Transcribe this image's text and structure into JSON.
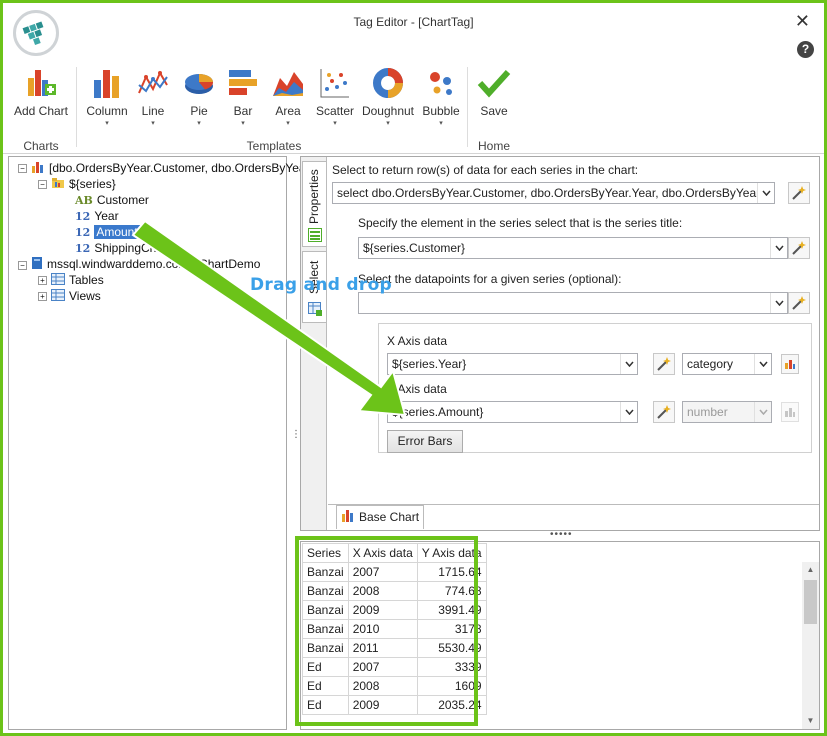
{
  "window": {
    "title": "Tag Editor - [ChartTag]",
    "close_glyph": "✕",
    "help_glyph": "?"
  },
  "ribbon": {
    "buttons": [
      {
        "label": "Add Chart",
        "icon": "add-chart-icon"
      },
      {
        "label": "Column",
        "icon": "column-chart-icon"
      },
      {
        "label": "Line",
        "icon": "line-chart-icon"
      },
      {
        "label": "Pie",
        "icon": "pie-chart-icon"
      },
      {
        "label": "Bar",
        "icon": "bar-chart-icon"
      },
      {
        "label": "Area",
        "icon": "area-chart-icon"
      },
      {
        "label": "Scatter",
        "icon": "scatter-chart-icon"
      },
      {
        "label": "Doughnut",
        "icon": "doughnut-chart-icon"
      },
      {
        "label": "Bubble",
        "icon": "bubble-chart-icon"
      },
      {
        "label": "Save",
        "icon": "save-checkmark-icon"
      }
    ],
    "groups": [
      "Charts",
      "Templates",
      "Home"
    ],
    "dropdown_glyph": "▾"
  },
  "tree": {
    "root": "[dbo.OrdersByYear.Customer, dbo.OrdersByYear.Year",
    "series": "${series}",
    "fields": [
      {
        "type": "AB",
        "name": "Customer"
      },
      {
        "type": "12",
        "name": "Year"
      },
      {
        "type": "12",
        "name": "Amount"
      },
      {
        "type": "12",
        "name": "ShippingCharge"
      }
    ],
    "datasource": "mssql.windwarddemo.com - ChartDemo",
    "children": [
      "Tables",
      "Views"
    ],
    "expand_minus": "−",
    "expand_plus": "+"
  },
  "tabs": {
    "vertical": [
      "Properties",
      "Select"
    ],
    "bottom": "Base Chart"
  },
  "form": {
    "select_label": "Select to return row(s) of data for each series in the chart:",
    "select_value": "select dbo.OrdersByYear.Customer, dbo.OrdersByYear.Year, dbo.OrdersByYear.Amount",
    "title_label": "Specify the element in the series select that is the series title:",
    "title_value": "${series.Customer}",
    "datapoints_label": "Select the datapoints for a given series (optional):",
    "datapoints_value": "",
    "x_label": "X Axis data",
    "x_value": "${series.Year}",
    "x_type": "category",
    "y_label": "Y Axis data",
    "y_value": "${series.Amount}",
    "y_type": "number",
    "error_bars": "Error Bars"
  },
  "annotation": {
    "text": "Drag and drop",
    "color": "#6cc319"
  },
  "grid": {
    "headers": [
      "Series",
      "X Axis data",
      "Y Axis data"
    ],
    "rows": [
      [
        "Banzai",
        "2007",
        "1715.64"
      ],
      [
        "Banzai",
        "2008",
        "774.68"
      ],
      [
        "Banzai",
        "2009",
        "3991.49"
      ],
      [
        "Banzai",
        "2010",
        "3178"
      ],
      [
        "Banzai",
        "2011",
        "5530.49"
      ],
      [
        "Ed",
        "2007",
        "3339"
      ],
      [
        "Ed",
        "2008",
        "1609"
      ],
      [
        "Ed",
        "2009",
        "2035.24"
      ]
    ],
    "scroll_up": "▲",
    "scroll_down": "▼"
  },
  "splitter_glyphs": {
    "horizontal": "•••••",
    "vertical": "⋮"
  }
}
